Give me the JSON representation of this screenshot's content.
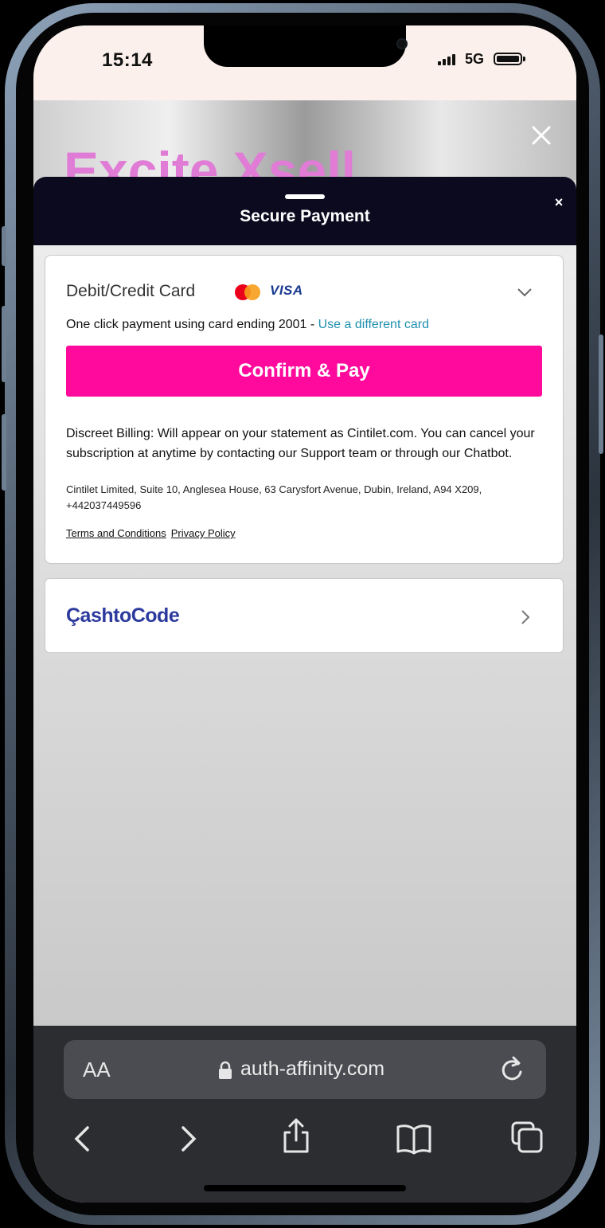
{
  "status_bar": {
    "time": "15:14",
    "network": "5G"
  },
  "background_page": {
    "banner_text": "Excite Xsell",
    "close_icon": "close-icon"
  },
  "modal": {
    "title": "Secure Payment",
    "close_label": "×"
  },
  "card_option": {
    "title": "Debit/Credit Card",
    "brands": [
      "mastercard-icon",
      "VISA"
    ],
    "one_click_text": "One click payment using card ending 2001 - ",
    "different_card_link": "Use a different card",
    "confirm_button": "Confirm & Pay",
    "billing_text": "Discreet Billing: Will appear on your statement as Cintilet.com. You can cancel your subscription at anytime by contacting our Support team or through our Chatbot.",
    "address_text": "Cintilet Limited, Suite 10, Anglesea House, 63 Carysfort Avenue, Dubin, Ireland, A94 X209, +442037449596",
    "terms_link": "Terms and Conditions",
    "privacy_link": "Privacy Policy"
  },
  "cashtocode_option": {
    "logo_text": "ÇashtoCode"
  },
  "browser": {
    "text_size_label": "AA",
    "url": "auth-affinity.com",
    "toolbar_icons": [
      "back-icon",
      "forward-icon",
      "share-icon",
      "bookmarks-icon",
      "tabs-icon"
    ]
  },
  "colors": {
    "accent_pink": "#ff0a9c",
    "modal_header": "#0c0a1f",
    "link_teal": "#1e8fae",
    "cashtocode_blue": "#2c3a9e"
  }
}
